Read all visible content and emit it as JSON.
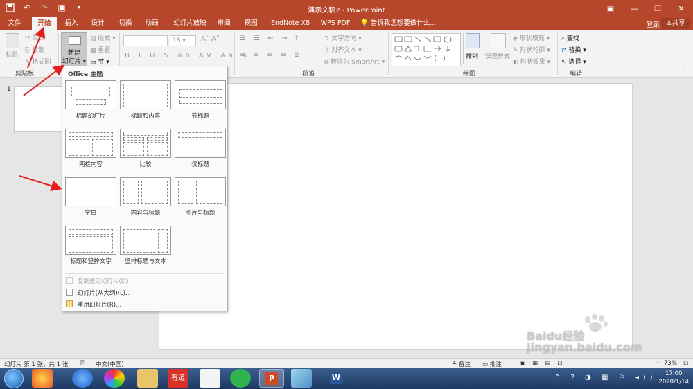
{
  "window": {
    "title": "演示文稿2 - PowerPoint"
  },
  "tabs": [
    {
      "label": "文件",
      "active": false
    },
    {
      "label": "开始",
      "active": true
    },
    {
      "label": "插入",
      "active": false
    },
    {
      "label": "设计",
      "active": false
    },
    {
      "label": "切换",
      "active": false
    },
    {
      "label": "动画",
      "active": false
    },
    {
      "label": "幻灯片放映",
      "active": false
    },
    {
      "label": "审阅",
      "active": false
    },
    {
      "label": "视图",
      "active": false
    },
    {
      "label": "EndNote X8",
      "active": false
    },
    {
      "label": "WPS PDF",
      "active": false
    }
  ],
  "tellme": "告诉我您想要做什么...",
  "login": "登录",
  "share": "共享",
  "ribbon": {
    "clipboard": {
      "paste": "粘贴",
      "cut": "剪切",
      "copy": "复制",
      "format_painter": "格式刷",
      "label": "剪贴板"
    },
    "slides": {
      "new_slide_line1": "新建",
      "new_slide_line2": "幻灯片",
      "layout": "版式",
      "reset": "重置",
      "section": "节"
    },
    "font": {
      "size": "18"
    },
    "paragraph": {
      "text_direction": "文字方向",
      "align_text": "对齐文本",
      "smartart": "转换为 SmartArt",
      "label": "段落"
    },
    "drawing": {
      "arrange": "排列",
      "quick_styles": "快速样式",
      "shape_fill": "形状填充",
      "shape_outline": "形状轮廓",
      "shape_effects": "形状效果",
      "label": "绘图"
    },
    "editing": {
      "find": "查找",
      "replace": "替换",
      "select": "选择",
      "label": "编辑"
    }
  },
  "dropdown": {
    "title": "Office 主题",
    "layouts": [
      "标题幻灯片",
      "标题和内容",
      "节标题",
      "两栏内容",
      "比较",
      "仅标题",
      "空白",
      "内容与标题",
      "图片与标题",
      "标题和竖排文字",
      "竖排标题与文本"
    ],
    "commands": [
      {
        "label": "复制选定幻灯片(D)",
        "disabled": true
      },
      {
        "label": "幻灯片(从大纲)(L)...",
        "disabled": false
      },
      {
        "label": "重用幻灯片(R)...",
        "disabled": false
      }
    ]
  },
  "slide_panel": {
    "number": "1"
  },
  "status": {
    "slide_info": "幻灯片 第 1 张，共 1 张",
    "language": "中文(中国)",
    "notes": "备注",
    "comments": "批注",
    "zoom": "73%"
  },
  "taskbar": {
    "time": "17:00",
    "date": "2020/1/14",
    "youdao": "有道"
  },
  "watermark": "Baidu经验 jingyan.baidu.com",
  "colors": {
    "accent": "#b7472a",
    "arrow": "#e32020"
  }
}
